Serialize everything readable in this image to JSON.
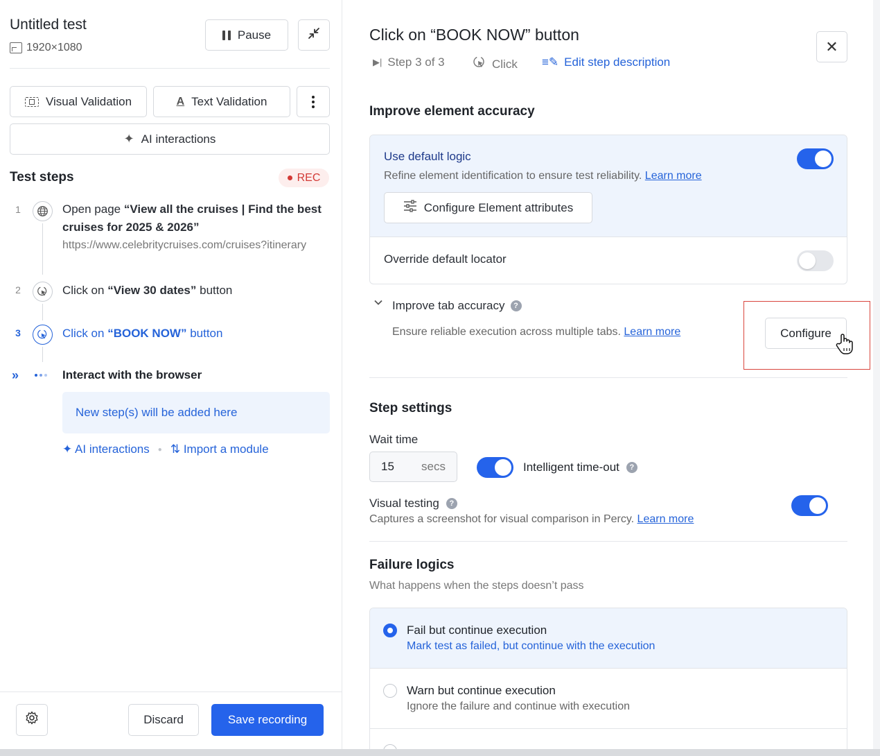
{
  "left": {
    "title": "Untitled test",
    "resolution": "1920×1080",
    "pause_label": "Pause",
    "visual_validation_label": "Visual Validation",
    "text_validation_label": "Text Validation",
    "ai_interactions_label": "AI interactions",
    "steps_title": "Test steps",
    "rec_label": "REC",
    "steps": [
      {
        "num": "1",
        "prefix": "Open page ",
        "bold": "“View all the cruises | Find the best cruises for 2025 & 2026”",
        "suffix": "",
        "url": "https://www.celebritycruises.com/cruises?itinerary"
      },
      {
        "num": "2",
        "prefix": "Click on ",
        "bold": "“View 30 dates”",
        "suffix": " button"
      },
      {
        "num": "3",
        "prefix": "Click on ",
        "bold": "“BOOK NOW”",
        "suffix": " button"
      }
    ],
    "interact_label": "Interact with the browser",
    "new_steps_label": "New step(s) will be added here",
    "ai_link_label": "AI interactions",
    "import_link_label": "Import a module",
    "discard_label": "Discard",
    "save_label": "Save recording"
  },
  "right": {
    "title": "Click on “BOOK NOW” button",
    "step_meta": "Step 3 of 3",
    "action_meta": "Click",
    "edit_link": "Edit step description",
    "accuracy_title": "Improve element accuracy",
    "default_logic_label": "Use default logic",
    "default_logic_desc": "Refine element identification to ensure test reliability.",
    "learn_more": "Learn more",
    "configure_attrs_label": "Configure Element attributes",
    "override_label": "Override default locator",
    "tab_accuracy_label": "Improve tab accuracy",
    "tab_accuracy_desc": "Ensure reliable execution across multiple tabs.",
    "configure_label": "Configure",
    "step_settings_title": "Step settings",
    "wait_label": "Wait time",
    "wait_value": "15",
    "wait_unit": "secs",
    "intelligent_label": "Intelligent time-out",
    "visual_testing_label": "Visual testing",
    "visual_testing_desc": "Captures a screenshot for visual comparison in Percy.",
    "failure_title": "Failure logics",
    "failure_desc": "What happens when the steps doesn’t pass",
    "options": [
      {
        "title": "Fail but continue execution",
        "desc": "Mark test as failed, but continue with the execution"
      },
      {
        "title": "Warn but continue execution",
        "desc": "Ignore the failure and continue with execution"
      }
    ]
  },
  "toggles": {
    "default_logic": true,
    "override_locator": false,
    "intelligent_timeout": true,
    "visual_testing": true
  },
  "colors": {
    "accent": "#2563eb",
    "highlight_box": "#d9453d",
    "rec": "#d33a36"
  }
}
